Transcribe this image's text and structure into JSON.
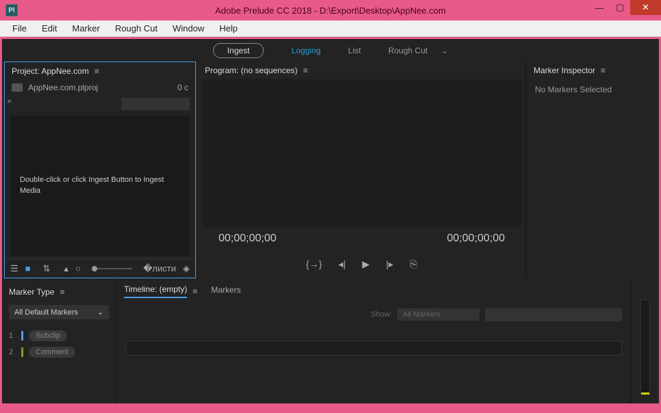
{
  "window": {
    "title": "Adobe Prelude CC 2018 - D:\\Export\\Desktop\\AppNee.com",
    "app_abbrev": "Pl"
  },
  "menubar": [
    "File",
    "Edit",
    "Marker",
    "Rough Cut",
    "Window",
    "Help"
  ],
  "workspace_tabs": {
    "ingest": "Ingest",
    "logging": "Logging",
    "list": "List",
    "rough_cut": "Rough Cut"
  },
  "project": {
    "title": "Project: AppNee.com",
    "filename": "AppNee.com.plproj",
    "clip_count": "0 c",
    "search_placeholder": "",
    "hint": "Double-click or click Ingest Button to Ingest Media"
  },
  "program": {
    "title": "Program: (no sequences)",
    "tc_in": "00;00;00;00",
    "tc_out": "00;00;00;00"
  },
  "inspector": {
    "title": "Marker Inspector",
    "empty": "No Markers Selected"
  },
  "marker_type": {
    "title": "Marker Type",
    "dropdown": "All Default Markers",
    "items": [
      {
        "num": "1",
        "color": "#4a9de8",
        "label": "Subclip"
      },
      {
        "num": "2",
        "color": "#8a9a2a",
        "label": "Comment"
      }
    ]
  },
  "timeline": {
    "tab_timeline": "Timeline: (empty)",
    "tab_markers": "Markers",
    "show_label": "Show:",
    "show_value": "All Markers"
  }
}
